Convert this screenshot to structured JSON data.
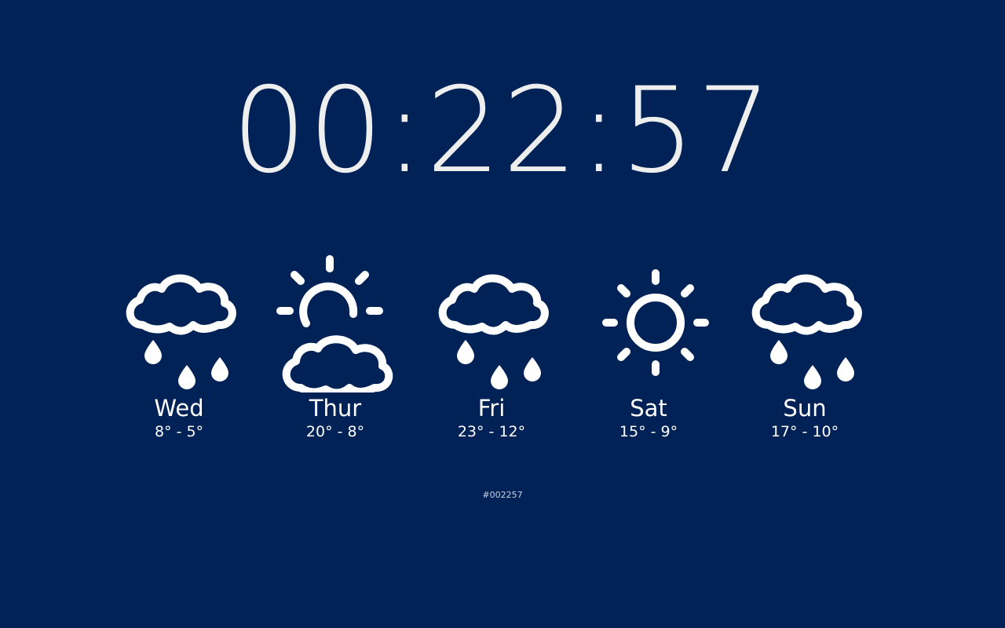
{
  "clock": {
    "time": "00:22:57"
  },
  "forecast": {
    "days": [
      {
        "name": "Wed",
        "temps": "8° - 5°",
        "icon": "rain-cloud-icon"
      },
      {
        "name": "Thur",
        "temps": "20° - 8°",
        "icon": "partly-cloudy-icon"
      },
      {
        "name": "Fri",
        "temps": "23° - 12°",
        "icon": "rain-cloud-icon"
      },
      {
        "name": "Sat",
        "temps": "15° - 9°",
        "icon": "sun-icon"
      },
      {
        "name": "Sun",
        "temps": "17° - 10°",
        "icon": "rain-cloud-icon"
      }
    ]
  },
  "footer": {
    "hex_code": "#002257"
  },
  "colors": {
    "background": "#002257",
    "foreground": "#ffffff"
  }
}
